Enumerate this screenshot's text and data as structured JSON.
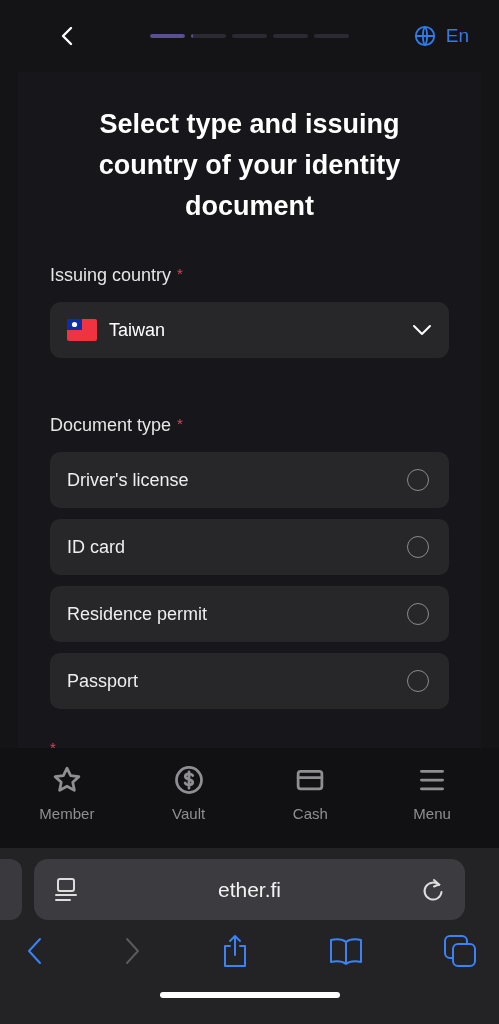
{
  "header": {
    "language": "En",
    "progress": [
      {
        "level": 1
      },
      {
        "level": 0.06
      },
      {
        "level": 0
      },
      {
        "level": 0
      },
      {
        "level": 0
      }
    ]
  },
  "title": "Select type and issuing country of your identity document",
  "country_field": {
    "label": "Issuing country",
    "required_mark": "*",
    "value": "Taiwan"
  },
  "document_type": {
    "label": "Document type",
    "required_mark": "*",
    "options": [
      {
        "label": "Driver's license",
        "selected": false
      },
      {
        "label": "ID card",
        "selected": false
      },
      {
        "label": "Residence permit",
        "selected": false
      },
      {
        "label": "Passport",
        "selected": false
      }
    ]
  },
  "footnote": {
    "mark": "*"
  },
  "nav": [
    {
      "label": "Member",
      "kind": "star"
    },
    {
      "label": "Vault",
      "kind": "dollar"
    },
    {
      "label": "Cash",
      "kind": "card"
    },
    {
      "label": "Menu",
      "kind": "menu"
    }
  ],
  "browser": {
    "url": "ether.fi",
    "toolbar": [
      {
        "kind": "back",
        "disabled": false
      },
      {
        "kind": "forward",
        "disabled": true
      },
      {
        "kind": "share",
        "disabled": false
      },
      {
        "kind": "book",
        "disabled": false
      },
      {
        "kind": "tabs",
        "disabled": false
      }
    ]
  }
}
